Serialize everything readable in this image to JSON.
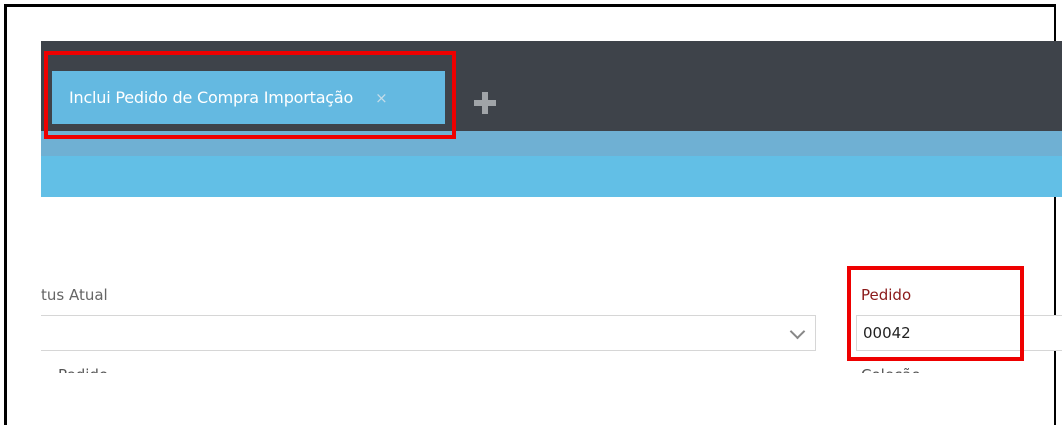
{
  "tabs": [
    {
      "label": "Inclui Pedido de Compra Importação",
      "close_glyph": "×"
    }
  ],
  "add_tab_icon": "plus-icon",
  "form": {
    "status_label": "tus Atual",
    "status_value": "",
    "pedido_label": "Pedido",
    "pedido_value": "00042",
    "row2_left_label": "Pedido",
    "row2_right_label": "Coleção"
  },
  "colors": {
    "tabbar": "#3e434a",
    "active_tab": "#64b9e1",
    "highlight": "#ee0000",
    "required_label": "#8b1a1a"
  }
}
